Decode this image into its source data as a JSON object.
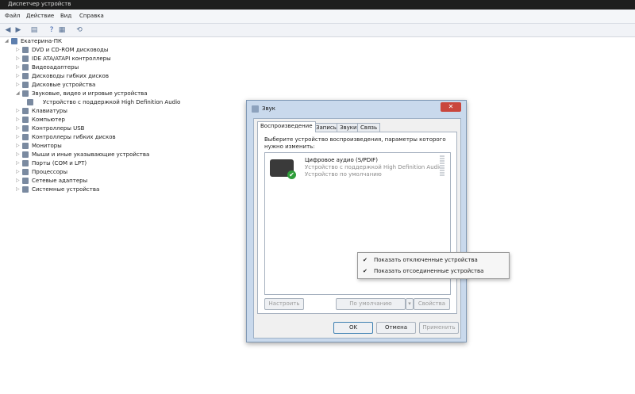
{
  "window": {
    "title": "Диспетчер устройств"
  },
  "menu": [
    "Файл",
    "Действие",
    "Вид",
    "Справка"
  ],
  "toolbar_icons": [
    "back-icon",
    "forward-icon",
    "properties-icon",
    "help-icon",
    "scan-icon"
  ],
  "tree": {
    "root": "Екатерина-ПК",
    "items": [
      {
        "label": "DVD и CD-ROM дисководы",
        "icon": "dvd-icon",
        "expanded": false
      },
      {
        "label": "IDE ATA/ATAPI контроллеры",
        "icon": "ide-icon",
        "expanded": false
      },
      {
        "label": "Видеоадаптеры",
        "icon": "display-adapter-icon",
        "expanded": false
      },
      {
        "label": "Дисководы гибких дисков",
        "icon": "floppy-icon",
        "expanded": false
      },
      {
        "label": "Дисковые устройства",
        "icon": "disk-icon",
        "expanded": false
      },
      {
        "label": "Звуковые, видео и игровые устройства",
        "icon": "sound-icon",
        "expanded": true
      },
      {
        "label": "Устройство с поддержкой High Definition Audio",
        "icon": "speaker-icon",
        "child": true
      },
      {
        "label": "Клавиатуры",
        "icon": "keyboard-icon",
        "expanded": false
      },
      {
        "label": "Компьютер",
        "icon": "computer-icon",
        "expanded": false
      },
      {
        "label": "Контроллеры USB",
        "icon": "usb-icon",
        "expanded": false
      },
      {
        "label": "Контроллеры гибких дисков",
        "icon": "floppy-controller-icon",
        "expanded": false
      },
      {
        "label": "Мониторы",
        "icon": "monitor-icon",
        "expanded": false
      },
      {
        "label": "Мыши и иные указывающие устройства",
        "icon": "mouse-icon",
        "expanded": false
      },
      {
        "label": "Порты (COM и LPT)",
        "icon": "port-icon",
        "expanded": false
      },
      {
        "label": "Процессоры",
        "icon": "cpu-icon",
        "expanded": false
      },
      {
        "label": "Сетевые адаптеры",
        "icon": "network-icon",
        "expanded": false
      },
      {
        "label": "Системные устройства",
        "icon": "system-icon",
        "expanded": false
      }
    ]
  },
  "dialog": {
    "title": "Звук",
    "close": "✕",
    "tabs": [
      "Воспроизведение",
      "Запись",
      "Звуки",
      "Связь"
    ],
    "prompt": "Выберите устройство воспроизведения, параметры которого нужно изменить:",
    "device": {
      "name": "Цифровое аудио (S/PDIF)",
      "line1": "Устройство с поддержкой High Definition Audio",
      "line2": "Устройство по умолчанию"
    },
    "buttons": {
      "configure": "Настроить",
      "default": "По умолчанию",
      "properties": "Свойства",
      "ok": "OK",
      "cancel": "Отмена",
      "apply": "Применить"
    }
  },
  "context_menu": [
    {
      "label": "Показать отключенные устройства",
      "checked": true
    },
    {
      "label": "Показать отсоединенные устройства",
      "checked": true
    }
  ]
}
